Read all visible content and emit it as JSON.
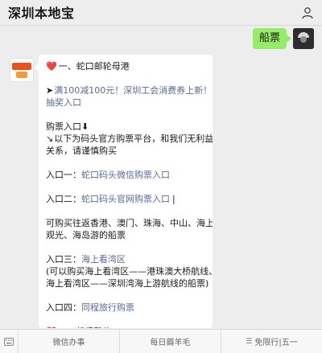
{
  "header": {
    "title": "深圳本地宝"
  },
  "out_message": {
    "text": "船票"
  },
  "in_message": {
    "lines": [
      {
        "prefix": "❤️",
        "text": "一、蛇口邮轮母港",
        "kind": "heading"
      },
      {
        "blank": true
      },
      {
        "prefix": "➤",
        "text": "满100减100元！深圳工会消费券上新！附",
        "kind": "link"
      },
      {
        "text": "抽奖入口",
        "kind": "link"
      },
      {
        "blank": true
      },
      {
        "text": "购票入口⬇",
        "kind": "plain"
      },
      {
        "prefix": "↘",
        "text": "以下为码头官方购票平台，和我们无利益",
        "kind": "plain"
      },
      {
        "text": "关系，请谨慎购买",
        "kind": "plain"
      },
      {
        "blank": true
      },
      {
        "label": "入口一：",
        "text": "蛇口码头微信购票入口",
        "kind": "entry"
      },
      {
        "blank": true
      },
      {
        "label": "入口二：",
        "text": "蛇口码头官网购票入口",
        "suffix": "|",
        "kind": "entry"
      },
      {
        "blank": true
      },
      {
        "text": "可购买往返香港、澳门、珠海、中山、海上",
        "kind": "plain"
      },
      {
        "text": "观光、海岛游的船票",
        "kind": "plain"
      },
      {
        "blank": true
      },
      {
        "label": "入口三：",
        "text": "海上看湾区",
        "kind": "entry"
      },
      {
        "text": "(可以购买海上看湾区——港珠澳大桥航线、",
        "kind": "plain"
      },
      {
        "text": "海上看湾区——深圳湾海上游航线的船票)",
        "kind": "plain"
      },
      {
        "blank": true
      },
      {
        "label": "入口四：",
        "text": "同程旅行购票",
        "kind": "entry"
      },
      {
        "blank": true
      },
      {
        "prefix": "❤️",
        "text": "二、机场码头",
        "kind": "heading"
      }
    ]
  },
  "bottom_menu": {
    "items": [
      {
        "label": "微信办事"
      },
      {
        "label": "每日薅羊毛"
      },
      {
        "label": "免限行|五一"
      }
    ]
  },
  "icons": {
    "profile": "person-icon",
    "keyboard_toggle": "keyboard-icon",
    "menu": "hamburger-icon"
  },
  "colors": {
    "bubble_out": "#95ec69",
    "link": "#576b95",
    "heart": "#e0245e"
  }
}
